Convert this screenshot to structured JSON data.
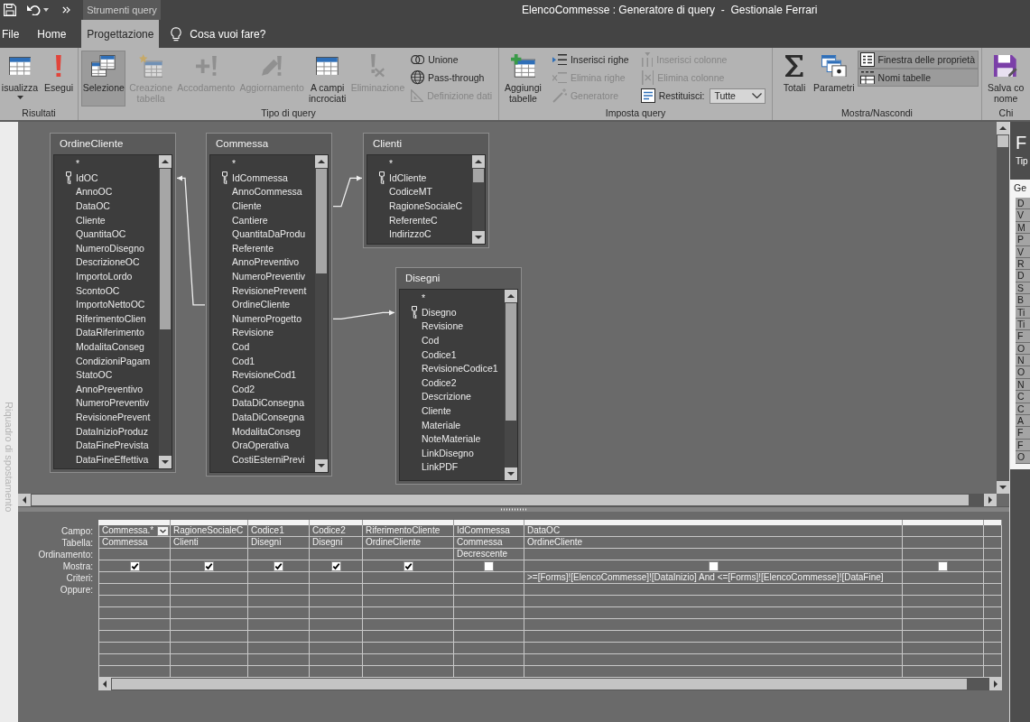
{
  "title_bar": {
    "contextual_tab": "Strumenti query",
    "title": "ElencoCommesse : Generatore di query  -  Gestionale Ferrari"
  },
  "tabs": [
    {
      "label": "File",
      "selected": false
    },
    {
      "label": "Home",
      "selected": false
    },
    {
      "label": "Progettazione",
      "selected": true
    }
  ],
  "tell_me": {
    "placeholder": "Cosa vuoi fare?"
  },
  "ribbon": {
    "groups": [
      {
        "label": "Risultati",
        "items": [
          {
            "kind": "menu",
            "label": "isualizza",
            "disabled": false,
            "selected": false
          },
          {
            "kind": "large",
            "label": "Esegui",
            "disabled": false,
            "selected": false
          }
        ]
      },
      {
        "label": "Tipo di query",
        "items": [
          {
            "kind": "large",
            "label": "Selezione",
            "disabled": false,
            "selected": true
          },
          {
            "kind": "large",
            "label": "Creazione\ntabella",
            "disabled": true,
            "selected": false
          },
          {
            "kind": "large",
            "label": "Accodamento",
            "disabled": true,
            "selected": false
          },
          {
            "kind": "large",
            "label": "Aggiornamento",
            "disabled": true,
            "selected": false
          },
          {
            "kind": "large",
            "label": "A campi\nincrociati",
            "disabled": false,
            "selected": false
          },
          {
            "kind": "large",
            "label": "Eliminazione",
            "disabled": true,
            "selected": false
          },
          {
            "kind": "small",
            "label": "Unione",
            "disabled": false,
            "selected": false
          },
          {
            "kind": "small",
            "label": "Pass-through",
            "disabled": false,
            "selected": false
          },
          {
            "kind": "small",
            "label": "Definizione dati",
            "disabled": true,
            "selected": false
          }
        ]
      },
      {
        "label": "Imposta query",
        "items": [
          {
            "kind": "large",
            "label": "Aggiungi\ntabelle",
            "disabled": false,
            "selected": false
          },
          {
            "kind": "small",
            "label": "Inserisci righe",
            "disabled": false,
            "selected": false
          },
          {
            "kind": "small",
            "label": "Elimina righe",
            "disabled": true,
            "selected": false
          },
          {
            "kind": "small",
            "label": "Generatore",
            "disabled": true,
            "selected": false
          },
          {
            "kind": "small",
            "label": "Inserisci colonne",
            "disabled": true,
            "selected": false
          },
          {
            "kind": "small",
            "label": "Elimina colonne",
            "disabled": true,
            "selected": false
          },
          {
            "kind": "combo",
            "label": "Restituisci:",
            "value": "Tutte",
            "disabled": false,
            "selected": false
          }
        ]
      },
      {
        "label": "Mostra/Nascondi",
        "items": [
          {
            "kind": "large",
            "label": "Totali",
            "disabled": false,
            "selected": false
          },
          {
            "kind": "large",
            "label": "Parametri",
            "disabled": false,
            "selected": false
          },
          {
            "kind": "small",
            "label": "Finestra delle proprietà",
            "disabled": false,
            "selected": true
          },
          {
            "kind": "small",
            "label": "Nomi tabelle",
            "disabled": false,
            "selected": true
          }
        ]
      },
      {
        "label": "Chi",
        "items": [
          {
            "kind": "large",
            "label": "Salva co\nnome",
            "disabled": false,
            "selected": false
          }
        ]
      }
    ]
  },
  "navigation_pane": {
    "label": "Riquadro di spostamento"
  },
  "tables": [
    {
      "title": "OrdineCliente",
      "fields": [
        {
          "name": "*",
          "primary_key": false
        },
        {
          "name": "IdOC",
          "primary_key": true
        },
        {
          "name": "AnnoOC",
          "primary_key": false
        },
        {
          "name": "DataOC",
          "primary_key": false
        },
        {
          "name": "Cliente",
          "primary_key": false
        },
        {
          "name": "QuantitaOC",
          "primary_key": false
        },
        {
          "name": "NumeroDisegno",
          "primary_key": false
        },
        {
          "name": "DescrizioneOC",
          "primary_key": false
        },
        {
          "name": "ImportoLordo",
          "primary_key": false
        },
        {
          "name": "ScontoOC",
          "primary_key": false
        },
        {
          "name": "ImportoNettoOC",
          "primary_key": false
        },
        {
          "name": "RiferimentoClien",
          "primary_key": false
        },
        {
          "name": "DataRiferimento",
          "primary_key": false
        },
        {
          "name": "ModalitaConseg",
          "primary_key": false
        },
        {
          "name": "CondizioniPagam",
          "primary_key": false
        },
        {
          "name": "StatoOC",
          "primary_key": false
        },
        {
          "name": "AnnoPreventivo",
          "primary_key": false
        },
        {
          "name": "NumeroPreventiv",
          "primary_key": false
        },
        {
          "name": "RevisionePrevent",
          "primary_key": false
        },
        {
          "name": "DataInizioProduz",
          "primary_key": false
        },
        {
          "name": "DataFinePrevista",
          "primary_key": false
        },
        {
          "name": "DataFineEffettiva",
          "primary_key": false
        }
      ]
    },
    {
      "title": "Commessa",
      "fields": [
        {
          "name": "*",
          "primary_key": false
        },
        {
          "name": "IdCommessa",
          "primary_key": true
        },
        {
          "name": "AnnoCommessa",
          "primary_key": false
        },
        {
          "name": "Cliente",
          "primary_key": false
        },
        {
          "name": "Cantiere",
          "primary_key": false
        },
        {
          "name": "QuantitaDaProdu",
          "primary_key": false
        },
        {
          "name": "Referente",
          "primary_key": false
        },
        {
          "name": "AnnoPreventivo",
          "primary_key": false
        },
        {
          "name": "NumeroPreventiv",
          "primary_key": false
        },
        {
          "name": "RevisionePrevent",
          "primary_key": false
        },
        {
          "name": "OrdineCliente",
          "primary_key": false
        },
        {
          "name": "NumeroProgetto",
          "primary_key": false
        },
        {
          "name": "Revisione",
          "primary_key": false
        },
        {
          "name": "Cod",
          "primary_key": false
        },
        {
          "name": "Cod1",
          "primary_key": false
        },
        {
          "name": "RevisioneCod1",
          "primary_key": false
        },
        {
          "name": "Cod2",
          "primary_key": false
        },
        {
          "name": "DataDiConsegna",
          "primary_key": false
        },
        {
          "name": "DataDiConsegna",
          "primary_key": false
        },
        {
          "name": "ModalitaConseg",
          "primary_key": false
        },
        {
          "name": "OraOperativa",
          "primary_key": false
        },
        {
          "name": "CostiEsterniPrevi",
          "primary_key": false
        }
      ]
    },
    {
      "title": "Clienti",
      "fields": [
        {
          "name": "*",
          "primary_key": false
        },
        {
          "name": "IdCliente",
          "primary_key": true
        },
        {
          "name": "CodiceMT",
          "primary_key": false
        },
        {
          "name": "RagioneSocialeC",
          "primary_key": false
        },
        {
          "name": "ReferenteC",
          "primary_key": false
        },
        {
          "name": "IndirizzoC",
          "primary_key": false
        }
      ]
    },
    {
      "title": "Disegni",
      "fields": [
        {
          "name": "*",
          "primary_key": false
        },
        {
          "name": "Disegno",
          "primary_key": true
        },
        {
          "name": "Revisione",
          "primary_key": false
        },
        {
          "name": "Cod",
          "primary_key": false
        },
        {
          "name": "Codice1",
          "primary_key": false
        },
        {
          "name": "RevisioneCodice1",
          "primary_key": false
        },
        {
          "name": "Codice2",
          "primary_key": false
        },
        {
          "name": "Descrizione",
          "primary_key": false
        },
        {
          "name": "Cliente",
          "primary_key": false
        },
        {
          "name": "Materiale",
          "primary_key": false
        },
        {
          "name": "NoteMateriale",
          "primary_key": false
        },
        {
          "name": "LinkDisegno",
          "primary_key": false
        },
        {
          "name": "LinkPDF",
          "primary_key": false
        }
      ]
    }
  ],
  "grid": {
    "row_labels": [
      "Campo:",
      "Tabella:",
      "Ordinamento:",
      "Mostra:",
      "Criteri:",
      "Oppure:"
    ],
    "columns": [
      {
        "field": "Commessa.*",
        "table": "Commessa",
        "show": true,
        "focused": true
      },
      {
        "field": "RagioneSocialeC",
        "table": "Clienti",
        "show": true,
        "focused": false
      },
      {
        "field": "Codice1",
        "table": "Disegni",
        "show": true,
        "focused": false
      },
      {
        "field": "Codice2",
        "table": "Disegni",
        "show": true,
        "focused": false
      },
      {
        "field": "RiferimentoCliente",
        "table": "OrdineCliente",
        "show": true,
        "focused": false
      },
      {
        "field": "IdCommessa",
        "table": "Commessa",
        "sort": "Decrescente",
        "show": false,
        "focused": false
      },
      {
        "field": "DataOC",
        "table": "OrdineCliente",
        "show": false,
        "focused": false,
        "criteria": ">=[Forms]![ElencoCommesse]![DataInizio] And <=[Forms]![ElencoCommesse]![DataFine]"
      },
      {
        "show": false,
        "focused": false
      }
    ]
  },
  "property_sheet": {
    "title": "F",
    "subtitle": "Tip",
    "tabs": [
      {
        "label": "Ge",
        "selected": true
      }
    ],
    "rows": [
      "D",
      "V",
      "M",
      "P",
      "V",
      "R",
      "D",
      "S",
      "B",
      "Ti",
      "Ti",
      "F",
      "O",
      "N",
      "O",
      "N",
      "C",
      "C",
      "A",
      "F",
      "F",
      "O"
    ]
  }
}
